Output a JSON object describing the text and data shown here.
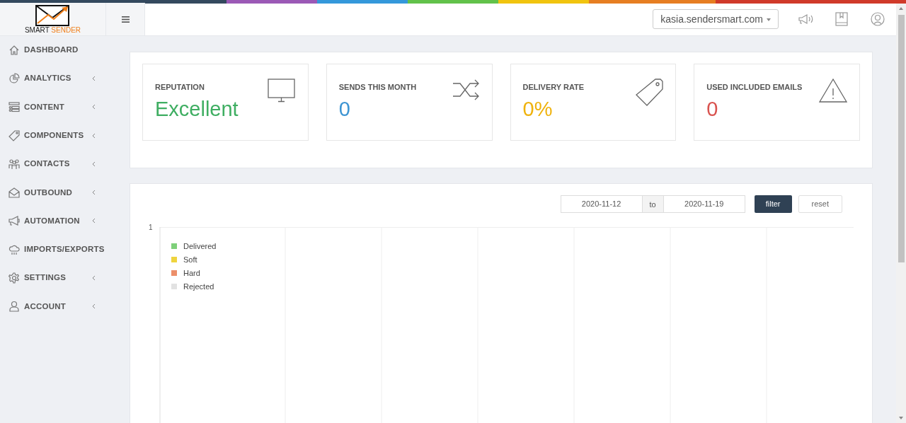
{
  "brand": {
    "word_1": "SMART",
    "word_2": "SENDER"
  },
  "header": {
    "account_dropdown": "kasia.sendersmart.com"
  },
  "sidebar": {
    "items": [
      {
        "label": "DASHBOARD",
        "kind": "home",
        "has_submenu": false
      },
      {
        "label": "ANALYTICS",
        "kind": "pie",
        "has_submenu": true
      },
      {
        "label": "CONTENT",
        "kind": "list",
        "has_submenu": true
      },
      {
        "label": "COMPONENTS",
        "kind": "tag",
        "has_submenu": true
      },
      {
        "label": "CONTACTS",
        "kind": "people",
        "has_submenu": true
      },
      {
        "label": "OUTBOUND",
        "kind": "mail",
        "has_submenu": true
      },
      {
        "label": "AUTOMATION",
        "kind": "megaphone",
        "has_submenu": true
      },
      {
        "label": "IMPORTS/EXPORTS",
        "kind": "cloud",
        "has_submenu": false
      },
      {
        "label": "SETTINGS",
        "kind": "gear",
        "has_submenu": true
      },
      {
        "label": "ACCOUNT",
        "kind": "user",
        "has_submenu": true
      }
    ]
  },
  "stats": [
    {
      "label": "REPUTATION",
      "value": "Excellent",
      "color": "#3fae62",
      "kind": "monitor"
    },
    {
      "label": "SENDS THIS MONTH",
      "value": "0",
      "color": "#3d95d3",
      "kind": "shuffle"
    },
    {
      "label": "DELIVERY RATE",
      "value": "0%",
      "color": "#efb20c",
      "kind": "tag"
    },
    {
      "label": "USED INCLUDED EMAILS",
      "value": "0",
      "color": "#d9534f",
      "kind": "warning"
    }
  ],
  "filter": {
    "date_from": "2020-11-12",
    "separator": "to",
    "date_to": "2020-11-19",
    "filter_button": "filter",
    "reset_button": "reset"
  },
  "chart": {
    "y_tick_label": "1",
    "legend": [
      {
        "label": "Delivered",
        "color": "#7ed07a"
      },
      {
        "label": "Soft",
        "color": "#efd43e"
      },
      {
        "label": "Hard",
        "color": "#ec8f6a"
      },
      {
        "label": "Rejected",
        "color": "#e2e2e2"
      }
    ]
  }
}
